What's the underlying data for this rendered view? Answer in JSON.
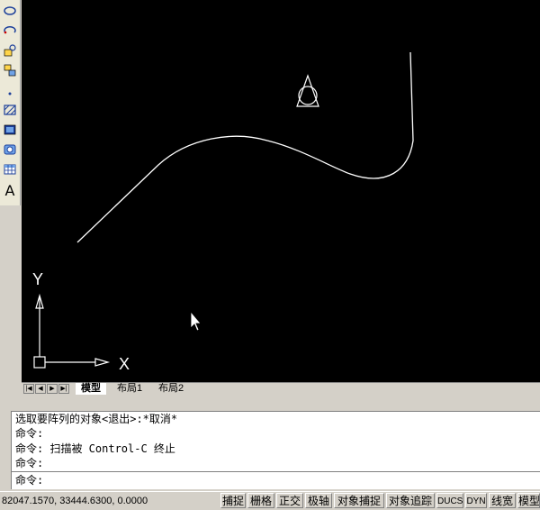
{
  "toolbar": {
    "icons": [
      "ellipse-icon",
      "ellipse-arc-icon",
      "insert-block-icon",
      "make-block-icon",
      "point-icon",
      "hatch-icon",
      "gradient-icon",
      "region-icon",
      "table-icon",
      "multiline-text-icon"
    ],
    "text_tool_label": "A"
  },
  "canvas": {
    "background": "#000000",
    "ucs_x_label": "X",
    "ucs_y_label": "Y"
  },
  "tabs": {
    "items": [
      "模型",
      "布局1",
      "布局2"
    ],
    "active": "模型",
    "nav_buttons": [
      "first-tab",
      "prev-tab",
      "next-tab",
      "last-tab"
    ]
  },
  "command_window": {
    "history": [
      "选取要阵列的对象<退出>:*取消*",
      "命令:",
      "命令: 扫描被 Control-C 终止",
      "命令:"
    ],
    "prompt": "命令:"
  },
  "status_bar": {
    "coordinates": "82047.1570, 33444.6300, 0.0000",
    "toggles": [
      "捕捉",
      "栅格",
      "正交",
      "极轴",
      "对象捕捉",
      "对象追踪",
      "DUCS",
      "DYN",
      "线宽",
      "模型"
    ]
  }
}
